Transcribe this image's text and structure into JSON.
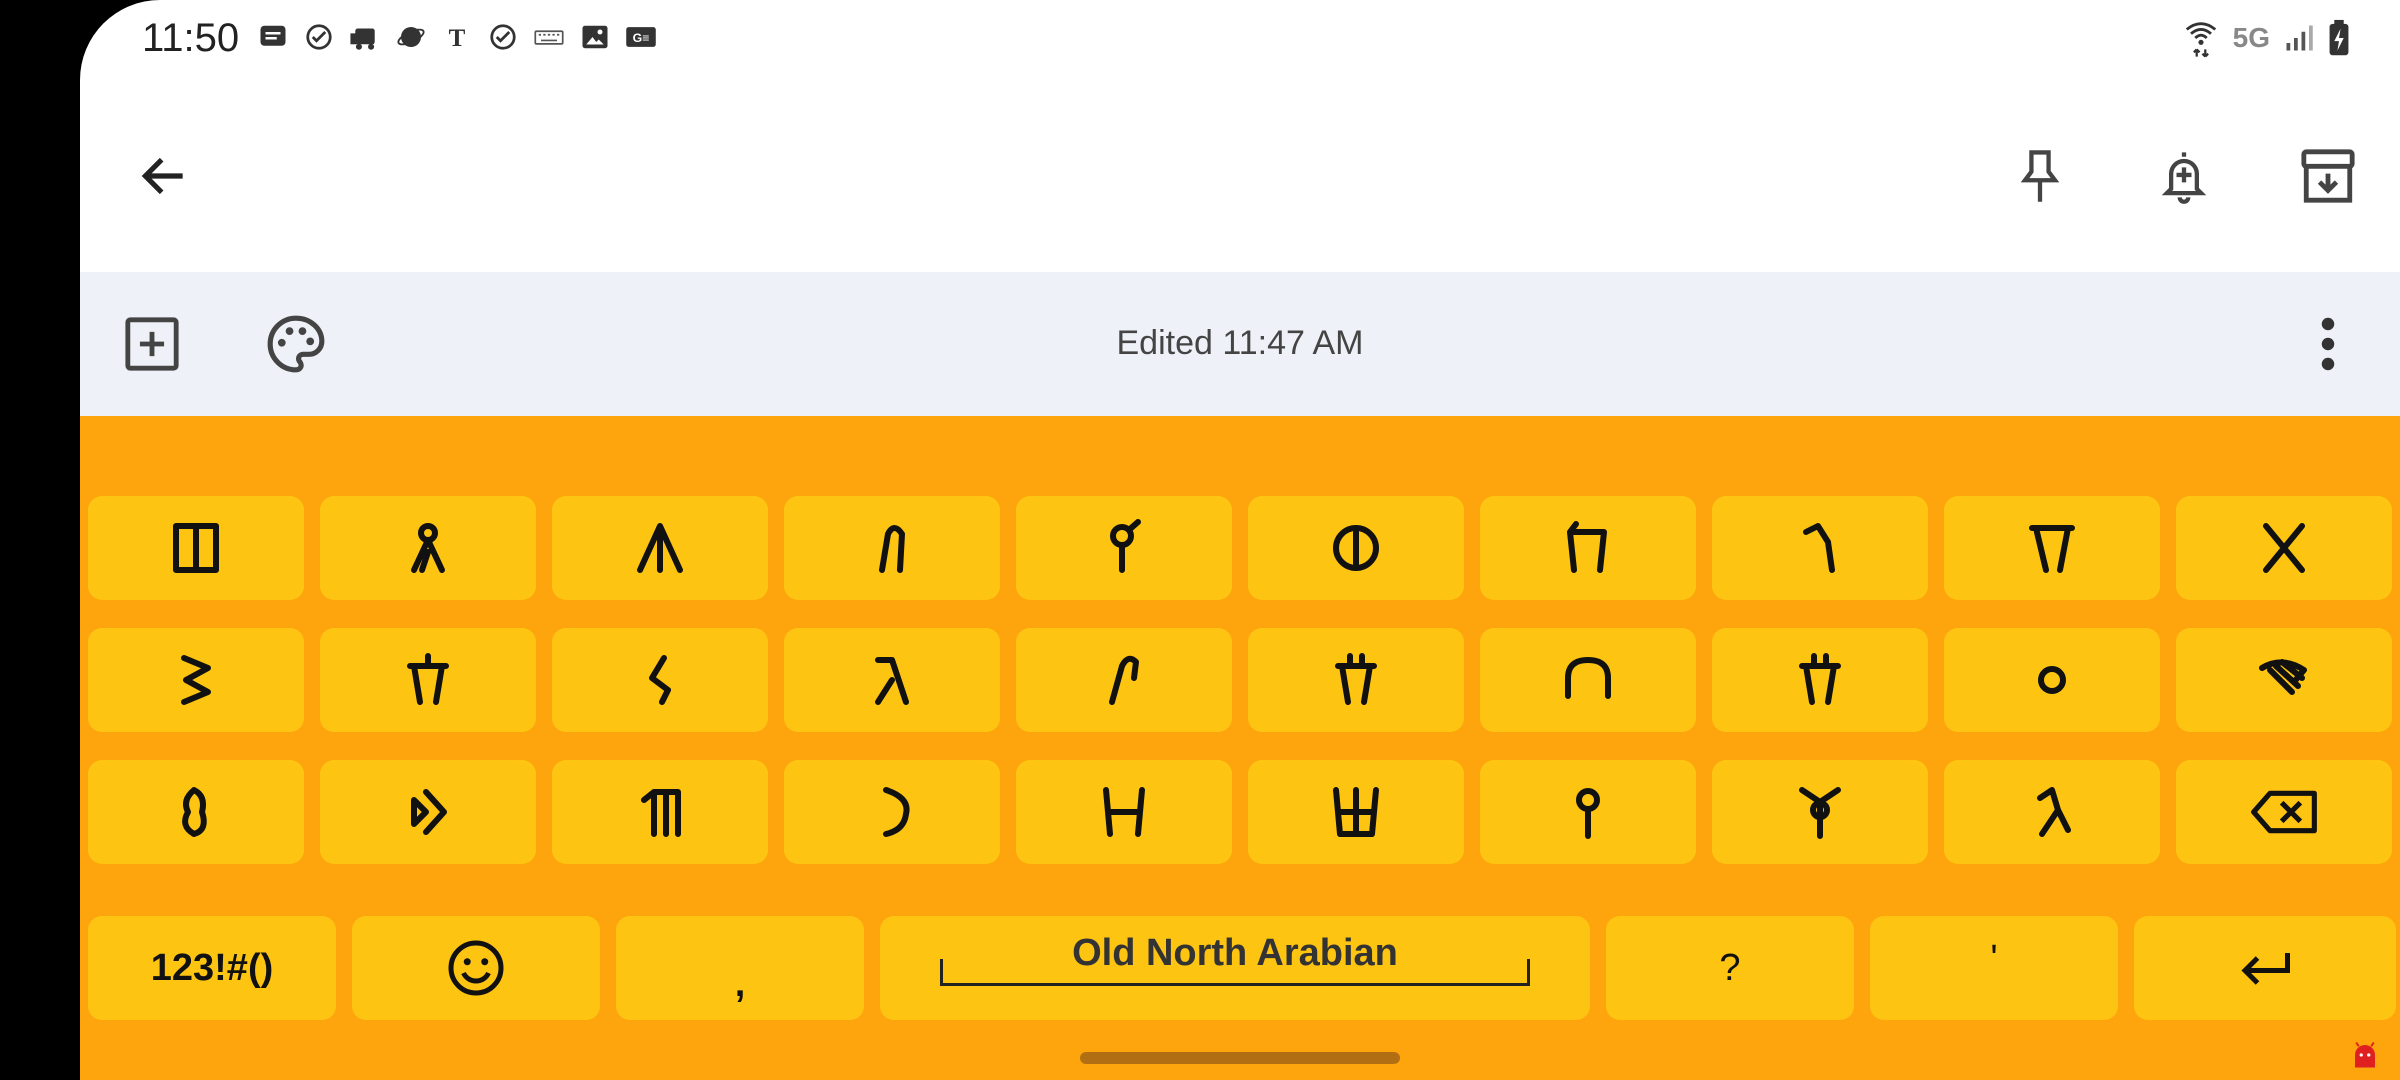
{
  "status_bar": {
    "time": "11:50",
    "network": "5G",
    "notification_icons": [
      "message-icon",
      "check-circle-icon",
      "train-icon",
      "planet-icon",
      "nyt-icon",
      "check-circle-icon",
      "keyboard-icon",
      "image-icon",
      "news-icon"
    ]
  },
  "note_toolbar": {
    "edited": "Edited 11:47 AM"
  },
  "keyboard": {
    "rows": [
      [
        "𐪈",
        "𐪑",
        "𐪆",
        "𐪅",
        "𐪇",
        "𐪊",
        "𐪃",
        "𐪓",
        "𐪂",
        "𐪉"
      ],
      [
        "𐪕",
        "𐪘",
        "𐪔",
        "𐪋",
        "𐪗",
        "𐪙",
        "𐪌",
        "𐪖",
        "𐪍",
        "𐪒"
      ],
      [
        "𐪀",
        "𐪛",
        "𐪁",
        "𐪄",
        "𐪎",
        "𐪏",
        "𐪐",
        "𐪜",
        "𐪚"
      ]
    ],
    "symbols_label": "123!#()",
    "comma_label": ",",
    "space_label": "Old North Arabian",
    "question_label": "?",
    "apostrophe_label": "'",
    "colors": {
      "background": "#fea50d",
      "key": "#fec412"
    }
  }
}
